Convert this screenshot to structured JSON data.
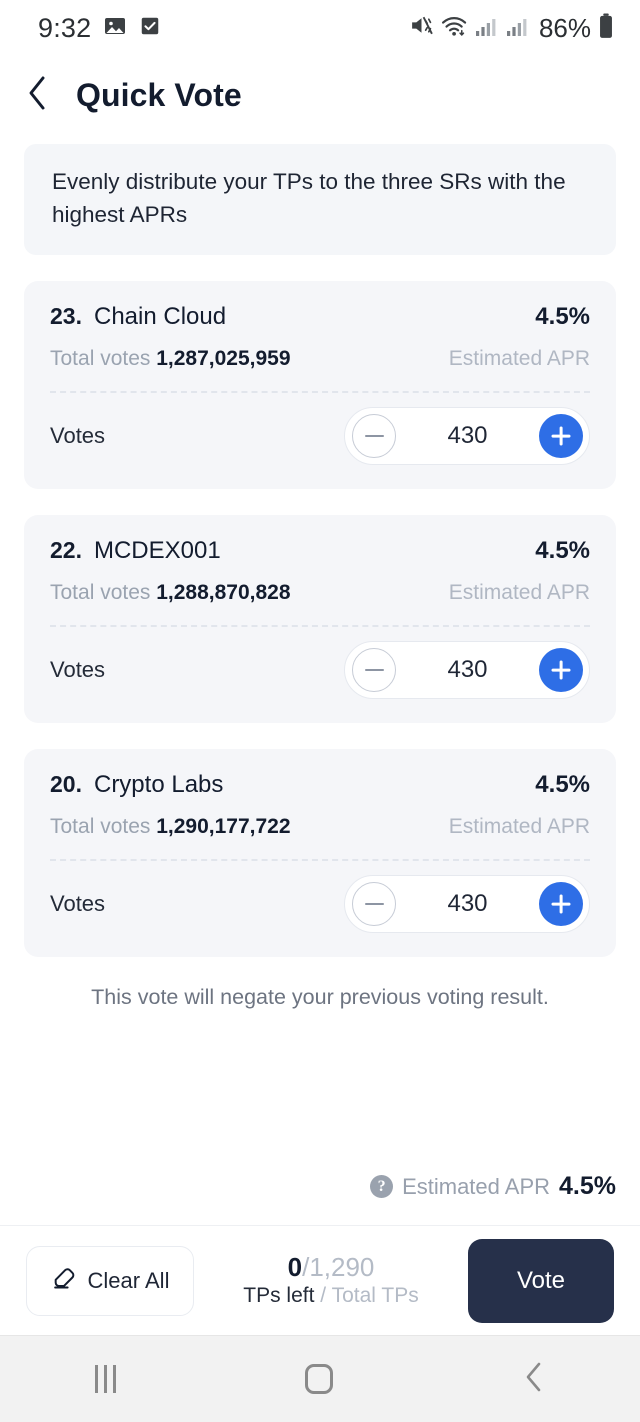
{
  "status_bar": {
    "time": "9:32",
    "battery_percent": "86%",
    "icons": [
      "image-icon",
      "checkbox-icon",
      "mute-icon",
      "wifi-icon",
      "signal-icon",
      "signal-icon",
      "battery-icon"
    ]
  },
  "header": {
    "title": "Quick Vote",
    "back_icon": "chevron-left-icon"
  },
  "banner": {
    "text": "Evenly distribute your TPs to the three SRs with the highest APRs"
  },
  "cards": [
    {
      "rank": "23.",
      "name": "Chain Cloud",
      "apr": "4.5%",
      "total_votes_label": "Total votes",
      "total_votes_value": "1,287,025,959",
      "apr_label": "Estimated APR",
      "votes_label": "Votes",
      "votes_value": "430"
    },
    {
      "rank": "22.",
      "name": "MCDEX001",
      "apr": "4.5%",
      "total_votes_label": "Total votes",
      "total_votes_value": "1,288,870,828",
      "apr_label": "Estimated APR",
      "votes_label": "Votes",
      "votes_value": "430"
    },
    {
      "rank": "20.",
      "name": "Crypto Labs",
      "apr": "4.5%",
      "total_votes_label": "Total votes",
      "total_votes_value": "1,290,177,722",
      "apr_label": "Estimated APR",
      "votes_label": "Votes",
      "votes_value": "430"
    }
  ],
  "notice": "This vote will negate your previous voting result.",
  "apr_summary": {
    "help_icon": "question-mark-icon",
    "label": "Estimated APR",
    "value": "4.5%"
  },
  "action_bar": {
    "clear_label": "Clear All",
    "clear_icon": "eraser-icon",
    "tps_left": "0",
    "tps_separator": "/",
    "tps_total": "1,290",
    "tps_left_caption": "TPs left",
    "tps_total_caption": " / Total TPs",
    "vote_label": "Vote"
  },
  "nav_bar": {
    "recents_icon": "recents-icon",
    "home_icon": "home-icon",
    "back_icon": "back-chevron-icon"
  },
  "colors": {
    "accent_blue": "#2e6ee6",
    "dark_navy": "#26304a",
    "card_bg": "#f5f6f9",
    "muted_text": "#9aa3b0"
  }
}
